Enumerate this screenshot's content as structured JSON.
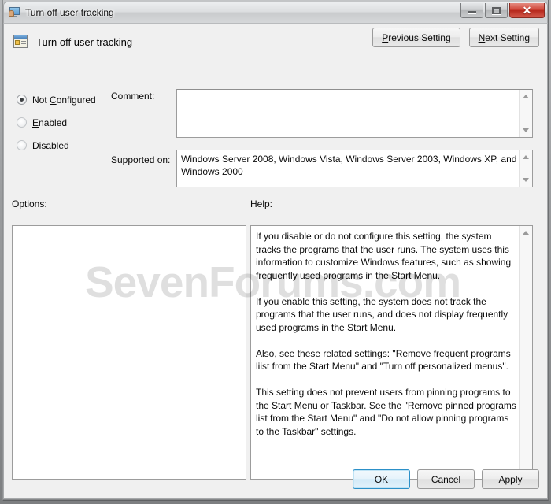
{
  "window": {
    "title": "Turn off user tracking",
    "title_icon": "monitor-user-icon",
    "controls": {
      "minimize": "Minimize",
      "maximize": "Maximize",
      "close": "✕"
    }
  },
  "header": {
    "policy_name": "Turn off user tracking",
    "policy_icon": "policy-setting-icon",
    "previous_setting": {
      "prefix": "",
      "accel": "P",
      "suffix": "revious Setting"
    },
    "next_setting": {
      "prefix": "",
      "accel": "N",
      "suffix": "ext Setting"
    }
  },
  "state_options": [
    {
      "label_prefix": "Not ",
      "accel": "C",
      "label_suffix": "onfigured",
      "checked": true,
      "enabled": true
    },
    {
      "label_prefix": "",
      "accel": "E",
      "label_suffix": "nabled",
      "checked": false,
      "enabled": false
    },
    {
      "label_prefix": "",
      "accel": "D",
      "label_suffix": "isabled",
      "checked": false,
      "enabled": false
    }
  ],
  "comment": {
    "label": "Comment:",
    "value": "",
    "placeholder": ""
  },
  "supported_on": {
    "label": "Supported on:",
    "value": "Windows Server 2008, Windows Vista, Windows Server 2003, Windows XP, and Windows 2000"
  },
  "options": {
    "label": "Options:",
    "value": ""
  },
  "help": {
    "label": "Help:",
    "text": "If you disable or do not configure this setting, the system tracks the programs that the user runs. The system uses this information to customize Windows features, such as showing frequently used programs in the Start Menu.\n\nIf you enable this setting, the system does not track the programs that the user runs, and does not display frequently used programs in the Start Menu.\n\nAlso, see these related settings: \"Remove frequent programs liist from the Start Menu\" and \"Turn off personalized menus\".\n\nThis setting does not prevent users from pinning programs to the Start Menu or Taskbar. See the \"Remove pinned programs list from the Start Menu\" and \"Do not allow pinning programs to the Taskbar\" settings."
  },
  "footer": {
    "ok": "OK",
    "cancel": "Cancel",
    "apply": {
      "accel": "A",
      "suffix": "pply"
    }
  },
  "watermark": "SevenForums.com",
  "colors": {
    "accent_blue": "#2c90c8",
    "close_red": "#b6281c",
    "dialog_bg": "#f0f0f0",
    "field_bg": "#ffffff"
  }
}
